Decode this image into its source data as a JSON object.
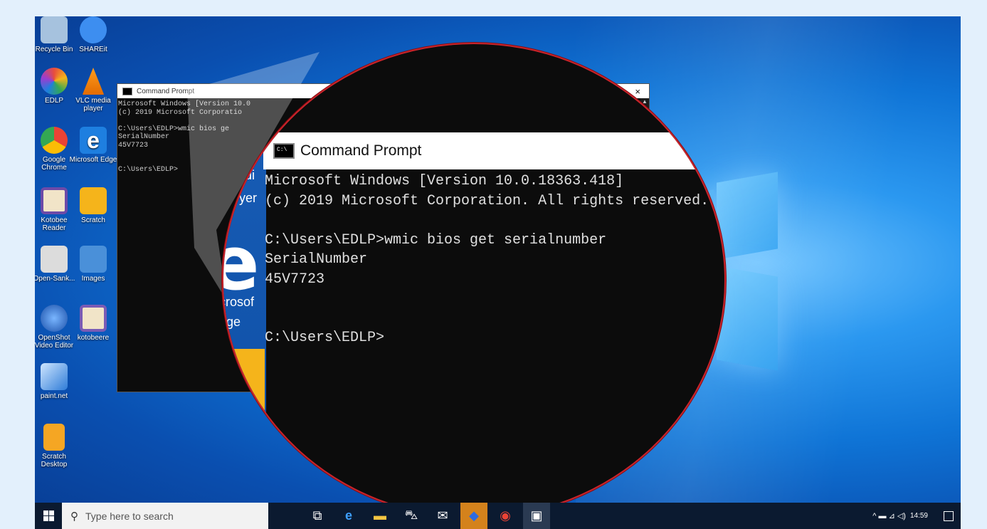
{
  "desktop_icons": [
    {
      "label": "Recycle Bin",
      "icon": "recycle-bin-icon",
      "color": "#9bb7d4"
    },
    {
      "label": "SHAREit",
      "icon": "shareit-icon",
      "color": "#3d8ef0"
    },
    {
      "label": "EDLP",
      "icon": "edlp-icon",
      "color": "#e84d3d"
    },
    {
      "label": "VLC media player",
      "icon": "vlc-icon",
      "color": "#f08a00"
    },
    {
      "label": "Google Chrome",
      "icon": "chrome-icon",
      "color": "#34a853"
    },
    {
      "label": "Microsoft Edge",
      "icon": "edge-icon",
      "color": "#1e7fe0"
    },
    {
      "label": "Kotobee Reader",
      "icon": "kotobee-reader-icon",
      "color": "#6d4aa8"
    },
    {
      "label": "Scratch",
      "icon": "scratch-icon",
      "color": "#f5b41b"
    },
    {
      "label": "Open-Sank...",
      "icon": "open-sankore-icon",
      "color": "#dcdcdc"
    },
    {
      "label": "Images",
      "icon": "images-folder-icon",
      "color": "#4a90d9"
    },
    {
      "label": "OpenShot Video Editor",
      "icon": "openshot-icon",
      "color": "#2b6fd1"
    },
    {
      "label": "kotobeere",
      "icon": "kotobee-author-icon",
      "color": "#7a5bb5"
    },
    {
      "label": "paint.net",
      "icon": "paintnet-icon",
      "color": "#2f7cd8"
    },
    {
      "label": "Scratch Desktop",
      "icon": "scratch-desktop-icon",
      "color": "#f5a623"
    }
  ],
  "cmd_window": {
    "title": "Command Prompt",
    "close_glyph": "×",
    "lines": [
      "Microsoft Windows [Version 10.0",
      "(c) 2019 Microsoft Corporatio",
      "",
      "C:\\Users\\EDLP>wmic bios ge",
      "SerialNumber",
      "45V7723",
      "",
      "",
      "C:\\Users\\EDLP>"
    ]
  },
  "magnifier": {
    "title": "Command Prompt",
    "edge_word_1": "crosof",
    "edge_word_2": "dge",
    "edge_word_3": "di",
    "edge_word_4": "yer",
    "lines": [
      "Microsoft Windows [Version 10.0.18363.418]",
      "(c) 2019 Microsoft Corporation. All rights reserved.",
      "",
      "C:\\Users\\EDLP>wmic bios get serialnumber",
      "SerialNumber",
      "45V7723",
      "",
      "",
      "C:\\Users\\EDLP>"
    ]
  },
  "taskbar": {
    "search_placeholder": "Type here to search",
    "time": "14:59",
    "apps": [
      {
        "name": "task-view-icon",
        "glyph": "⧉"
      },
      {
        "name": "edge-taskbar-icon",
        "glyph": "e"
      },
      {
        "name": "file-explorer-icon",
        "glyph": "▬"
      },
      {
        "name": "store-icon",
        "glyph": "⛍"
      },
      {
        "name": "mail-icon",
        "glyph": "✉"
      },
      {
        "name": "shield-taskbar-icon",
        "glyph": "◆"
      },
      {
        "name": "chrome-taskbar-icon",
        "glyph": "◉"
      },
      {
        "name": "cmd-taskbar-icon",
        "glyph": "▣"
      }
    ],
    "tray_glyphs": "^ ▬ ⊿ ◁)"
  }
}
